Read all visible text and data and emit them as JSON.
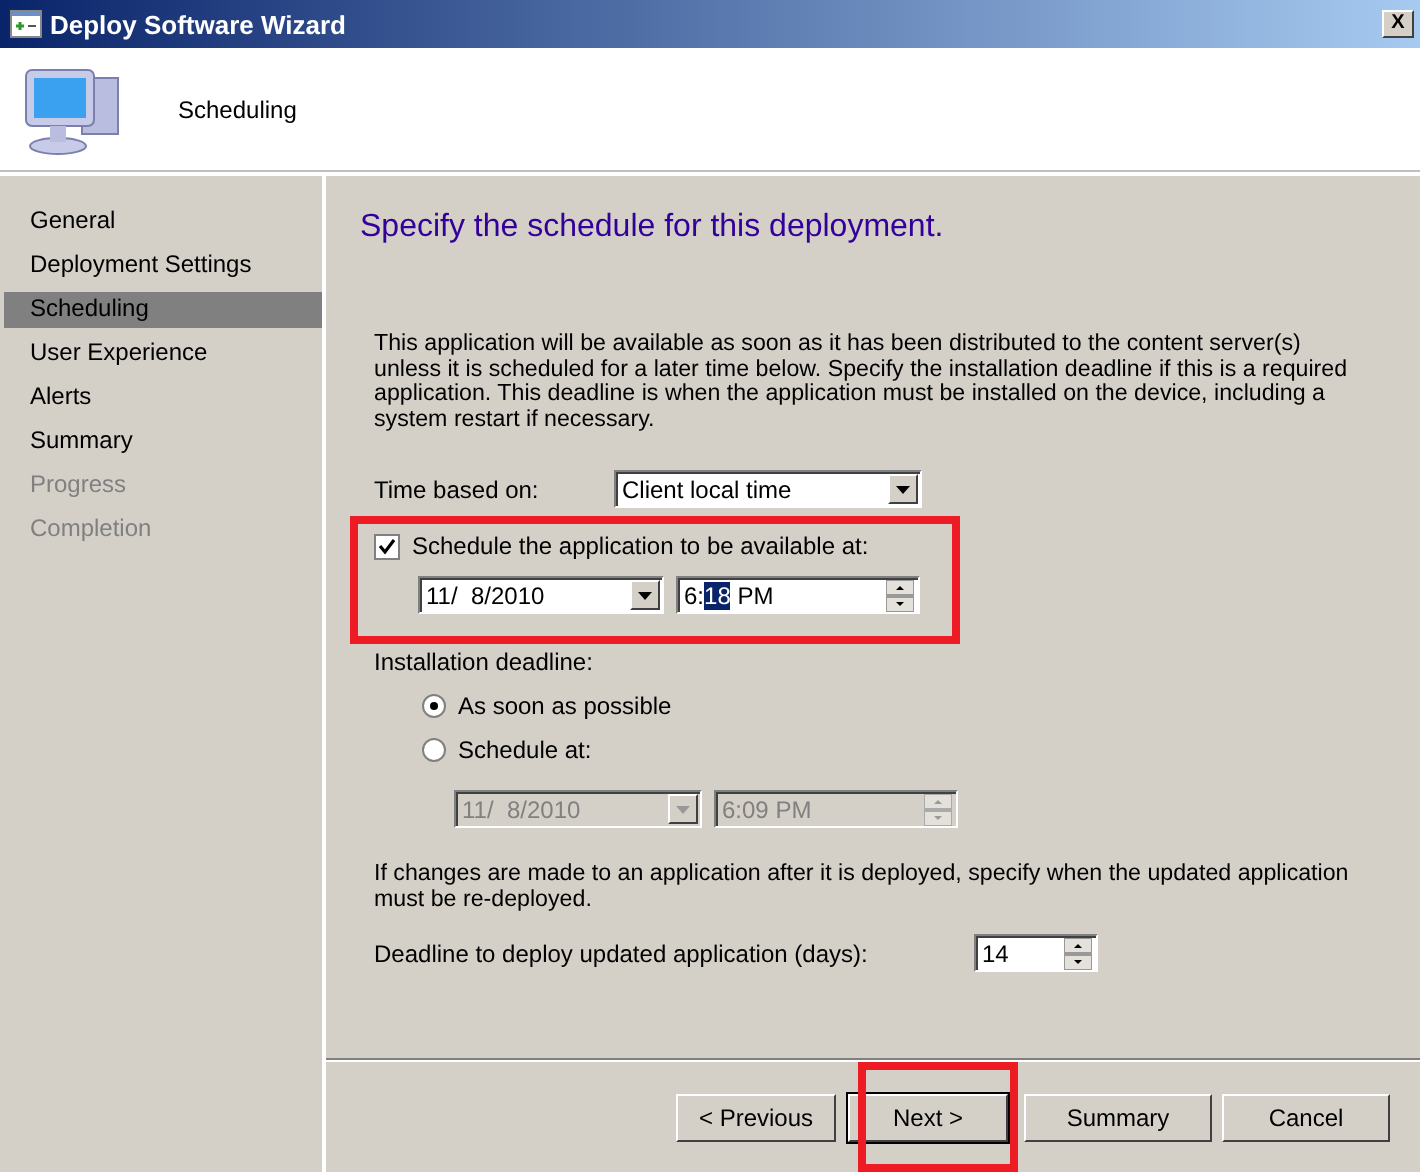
{
  "window": {
    "title": "Deploy Software Wizard",
    "close": "X"
  },
  "header": {
    "title": "Scheduling"
  },
  "nav": [
    {
      "label": "General",
      "selected": false,
      "disabled": false
    },
    {
      "label": "Deployment Settings",
      "selected": false,
      "disabled": false
    },
    {
      "label": "Scheduling",
      "selected": true,
      "disabled": false
    },
    {
      "label": "User Experience",
      "selected": false,
      "disabled": false
    },
    {
      "label": "Alerts",
      "selected": false,
      "disabled": false
    },
    {
      "label": "Summary",
      "selected": false,
      "disabled": false
    },
    {
      "label": "Progress",
      "selected": false,
      "disabled": true
    },
    {
      "label": "Completion",
      "selected": false,
      "disabled": true
    }
  ],
  "heading": "Specify the schedule for this deployment.",
  "intro": "This application will be available as soon as it has been distributed to the content server(s) unless it is scheduled for a later time below. Specify the installation deadline if this is a required application. This deadline is when the application must be installed on the device, including a system restart if necessary.",
  "time_based": {
    "label": "Time based on:",
    "value": "Client local time"
  },
  "availability": {
    "label": "Schedule the application to be available at:",
    "checked": true,
    "date": "11/  8/2010",
    "time_parts": [
      {
        "text": "6:",
        "selected": false
      },
      {
        "text": "18",
        "selected": true
      },
      {
        "text": " PM",
        "selected": false
      }
    ]
  },
  "deadline": {
    "label": "Installation deadline:",
    "options": [
      {
        "label": "As soon as possible",
        "selected": true
      },
      {
        "label": "Schedule at:",
        "selected": false
      }
    ],
    "date": "11/  8/2010",
    "time": "6:09 PM",
    "disabled": true
  },
  "redeploy_note": "If changes are made to an application after it is deployed, specify when the updated application must be re-deployed.",
  "redeploy": {
    "label": "Deadline to deploy updated application (days):",
    "value": "14"
  },
  "buttons": [
    {
      "label": "< Previous",
      "default": false
    },
    {
      "label": "Next >",
      "default": true
    },
    {
      "label": "Summary",
      "default": false
    },
    {
      "label": "Cancel",
      "default": false
    }
  ]
}
